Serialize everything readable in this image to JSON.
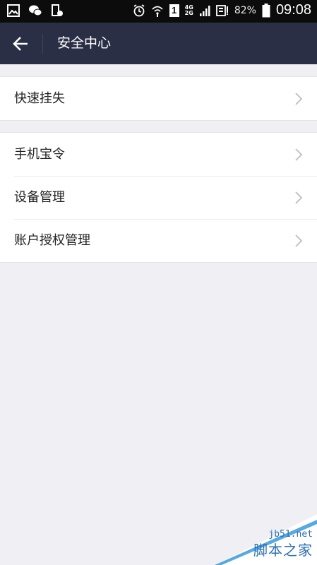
{
  "status_bar": {
    "battery_percent": "82%",
    "time": "09:08",
    "network_top": "4G",
    "network_bottom": "2G",
    "sim_label": "1"
  },
  "header": {
    "title": "安全中心"
  },
  "groups": [
    {
      "items": [
        {
          "label": "快速挂失"
        }
      ]
    },
    {
      "items": [
        {
          "label": "手机宝令"
        },
        {
          "label": "设备管理"
        },
        {
          "label": "账户授权管理"
        }
      ]
    }
  ],
  "watermark": {
    "domain": "jb51.net",
    "name": "脚本之家"
  },
  "colors": {
    "header_bg": "#2a2f45",
    "page_bg": "#efeff4",
    "row_bg": "#ffffff",
    "watermark": "#2d6fb3"
  }
}
